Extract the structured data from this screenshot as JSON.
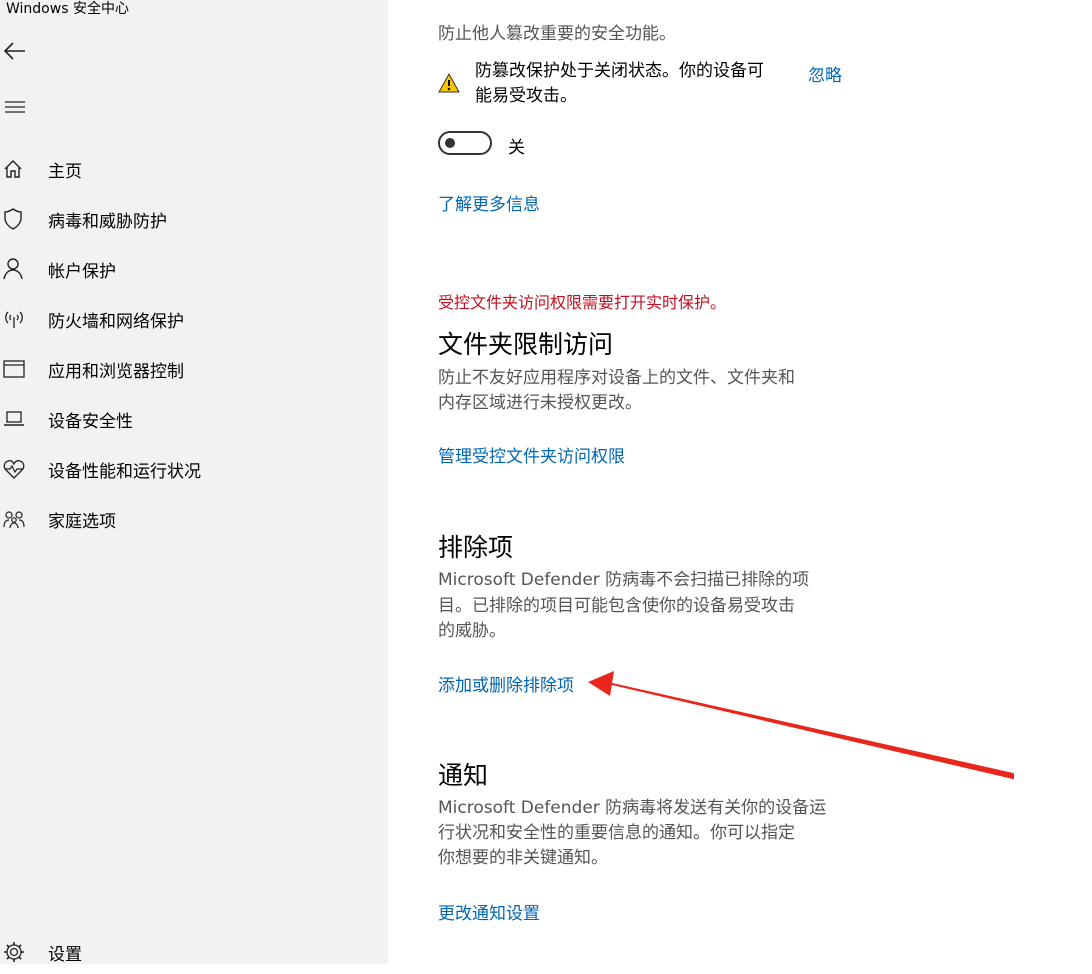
{
  "window": {
    "title": "Windows 安全中心"
  },
  "sidebar": {
    "back_icon": "back-arrow-icon",
    "menu_icon": "hamburger-icon",
    "items": [
      {
        "label": "主页",
        "icon": "home-icon"
      },
      {
        "label": "病毒和威胁防护",
        "icon": "shield-icon"
      },
      {
        "label": "帐户保护",
        "icon": "person-icon"
      },
      {
        "label": "防火墙和网络保护",
        "icon": "wireless-icon"
      },
      {
        "label": "应用和浏览器控制",
        "icon": "app-window-icon"
      },
      {
        "label": "设备安全性",
        "icon": "laptop-icon"
      },
      {
        "label": "设备性能和运行状况",
        "icon": "heart-pulse-icon"
      },
      {
        "label": "家庭选项",
        "icon": "family-icon"
      }
    ],
    "settings": {
      "label": "设置",
      "icon": "gear-icon"
    }
  },
  "tamper": {
    "desc_partial": "防止他人篡改重要的安全功能。",
    "warning_line1": "防篡改保护处于关闭状态。你的设备可",
    "warning_line2": "能易受攻击。",
    "ignore_link": "忽略",
    "toggle_state": "关",
    "learn_more": "了解更多信息"
  },
  "folder_access": {
    "error": "受控文件夹访问权限需要打开实时保护。",
    "heading": "文件夹限制访问",
    "desc_line1": "防止不友好应用程序对设备上的文件、文件夹和",
    "desc_line2": "内存区域进行未授权更改。",
    "link": "管理受控文件夹访问权限"
  },
  "exclusions": {
    "heading": "排除项",
    "desc_line1": "Microsoft Defender 防病毒不会扫描已排除的项",
    "desc_line2": "目。已排除的项目可能包含使你的设备易受攻击",
    "desc_line3": "的威胁。",
    "link": "添加或删除排除项"
  },
  "notifications": {
    "heading": "通知",
    "desc_line1": "Microsoft Defender 防病毒将发送有关你的设备运",
    "desc_line2": "行状况和安全性的重要信息的通知。你可以指定",
    "desc_line3": "你想要的非关键通知。",
    "link": "更改通知设置"
  },
  "colors": {
    "link": "#0067b8",
    "error": "#c50f1f",
    "warning": "#f7c600",
    "annotation_arrow": "#e8261c"
  }
}
